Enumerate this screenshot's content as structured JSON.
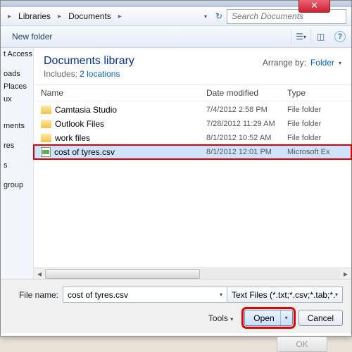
{
  "breadcrumb": {
    "item1": "Libraries",
    "item2": "Documents"
  },
  "search": {
    "placeholder": "Search Documents"
  },
  "toolbar": {
    "new_folder": "New folder"
  },
  "library": {
    "title": "Documents library",
    "includes_label": "Includes:",
    "locations": "2 locations",
    "arrange_label": "Arrange by:",
    "arrange_value": "Folder"
  },
  "columns": {
    "name": "Name",
    "date": "Date modified",
    "type": "Type"
  },
  "sidebar": {
    "items": [
      "t Access",
      "",
      "oads",
      "Places",
      "ux",
      "",
      "",
      "ments",
      "",
      "res",
      "",
      "s",
      "",
      "­group",
      ""
    ]
  },
  "files": [
    {
      "name": "Camtasia Studio",
      "date": "7/4/2012 2:58 PM",
      "type": "File folder",
      "icon": "folder"
    },
    {
      "name": "Outlook Files",
      "date": "7/28/2012 11:29 AM",
      "type": "File folder",
      "icon": "folder"
    },
    {
      "name": "work files",
      "date": "8/1/2012 10:52 AM",
      "type": "File folder",
      "icon": "folder"
    },
    {
      "name": "cost of tyres.csv",
      "date": "8/1/2012 12:01 PM",
      "type": "Microsoft Ex",
      "icon": "csv",
      "selected": true,
      "highlight": true
    }
  ],
  "bottom": {
    "filename_label": "File name:",
    "filename_value": "cost of tyres.csv",
    "filter": "Text Files (*.txt;*.csv;*.tab;*.asc)",
    "tools": "Tools",
    "open": "Open",
    "cancel": "Cancel"
  },
  "dialog_behind": {
    "ok": "OK"
  }
}
